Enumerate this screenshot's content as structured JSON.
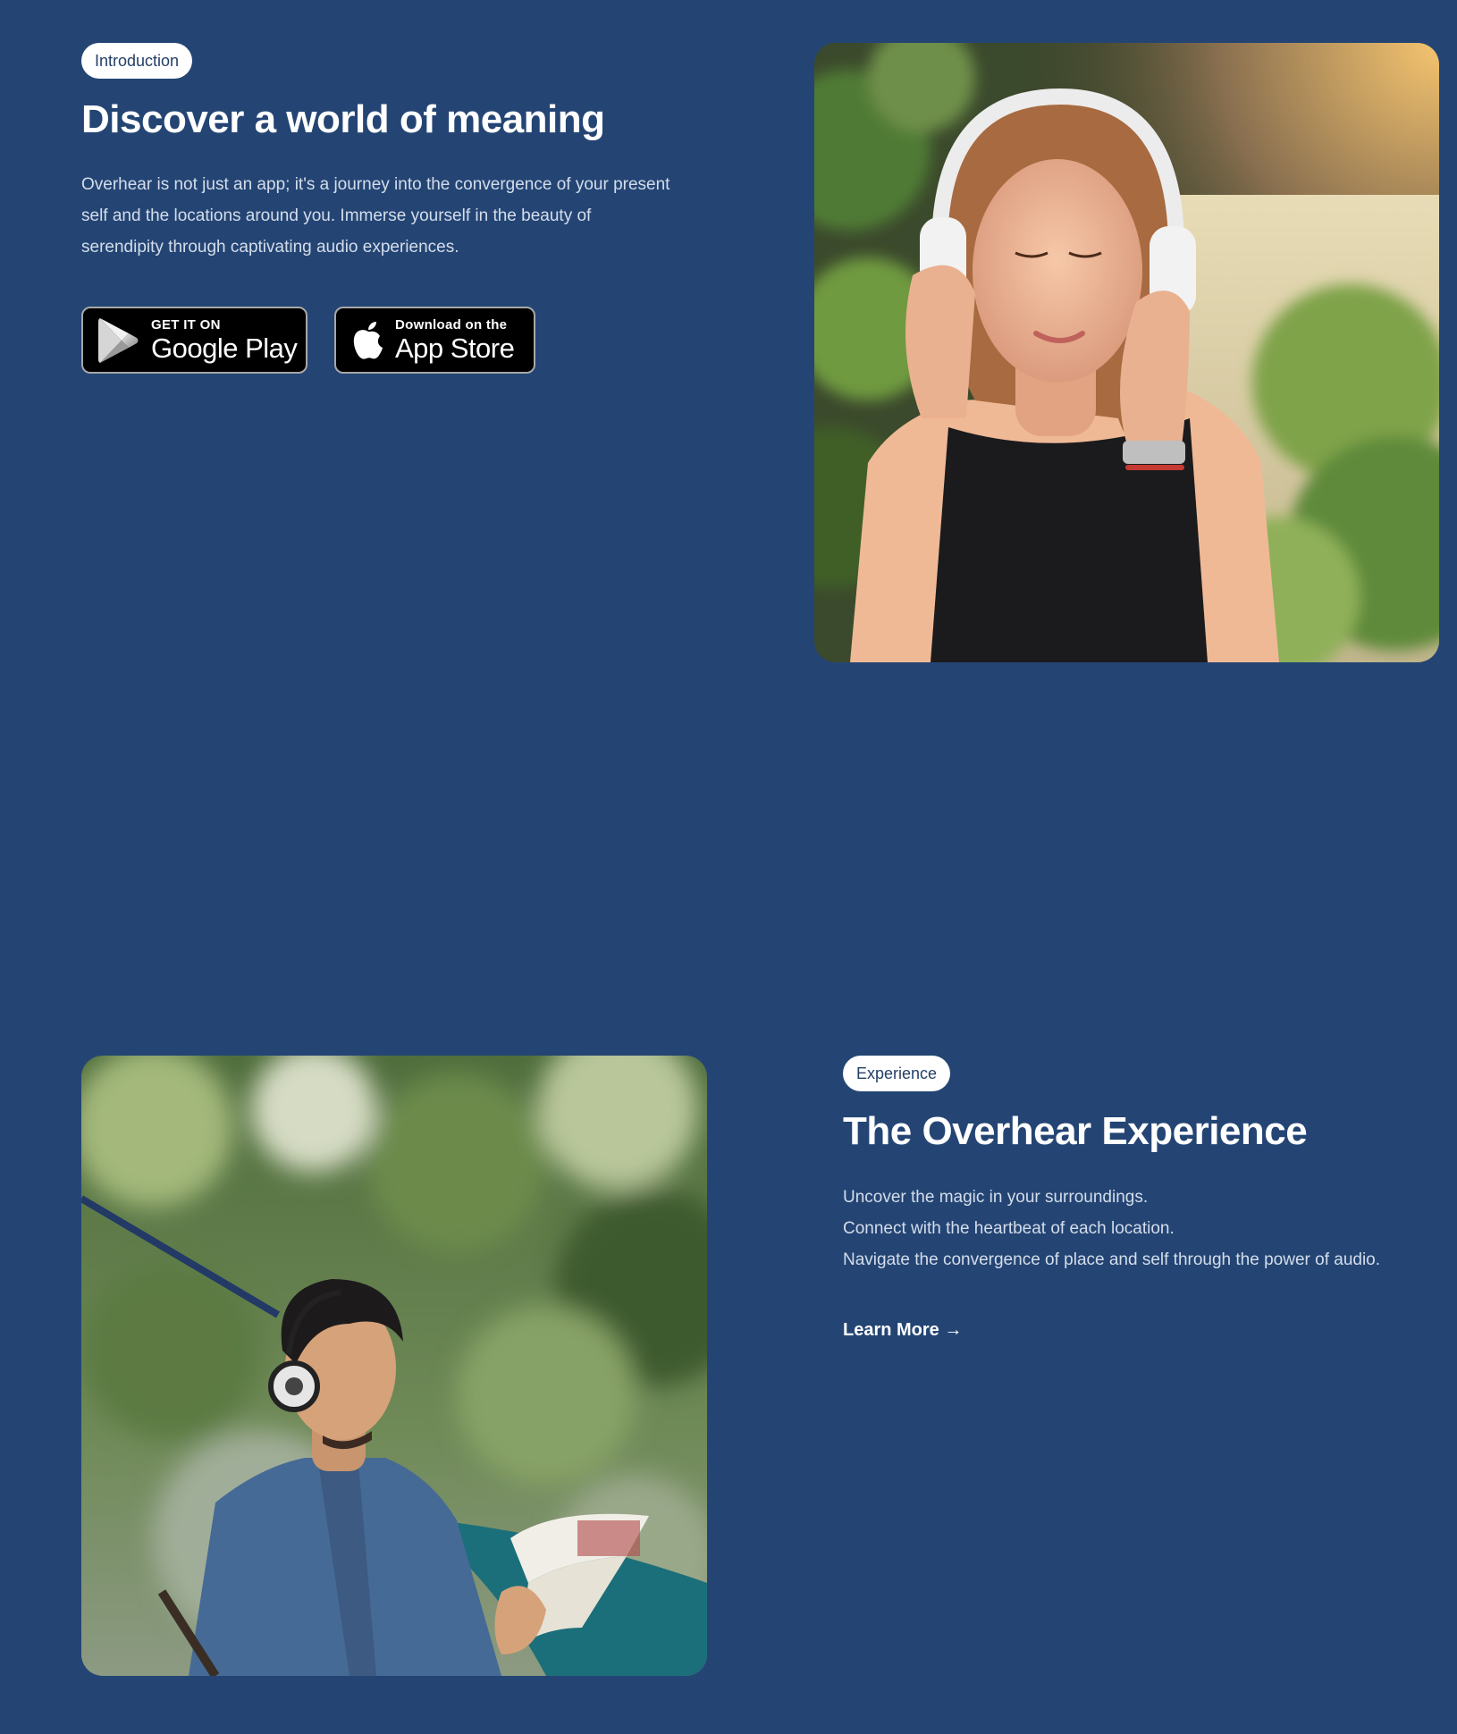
{
  "intro": {
    "badge": "Introduction",
    "heading": "Discover a world of meaning",
    "body_lines": [
      "Overhear is not just an app; it's a journey into the convergence of your present",
      "self and the locations around you. Immerse yourself in the beauty of",
      "serendipity through captivating audio experiences."
    ],
    "google_play": {
      "small": "GET IT ON",
      "big": "Google Play",
      "icon": "google-play-icon"
    },
    "app_store": {
      "small": "Download on the",
      "big": "App Store",
      "icon": "apple-icon"
    }
  },
  "experience": {
    "badge": "Experience",
    "heading": "The Overhear Experience",
    "body_lines": [
      "Uncover the magic in your surroundings.",
      "Connect with the heartbeat of each location.",
      "Navigate the convergence of place and self through the power of audio."
    ],
    "link": "Learn More →"
  },
  "colors": {
    "background": "#244574",
    "badge_text": "#243f66",
    "body_text": "#d4ddea"
  }
}
